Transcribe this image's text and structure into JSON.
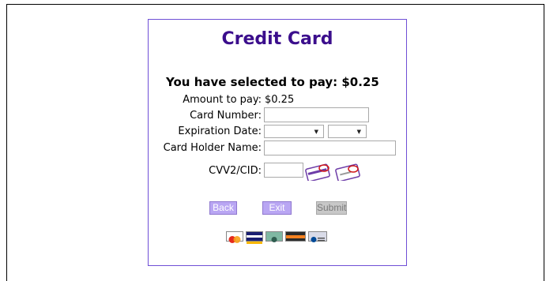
{
  "panel": {
    "title": "Credit Card",
    "headline": "You have selected to pay: $0.25"
  },
  "form": {
    "amount_label": "Amount to pay:",
    "amount_value": "$0.25",
    "card_number_label": "Card Number:",
    "card_number_value": "",
    "expiration_label": "Expiration Date:",
    "expiration_month": "",
    "expiration_year": "",
    "holder_label": "Card Holder Name:",
    "holder_value": "",
    "cvv_label": "CVV2/CID:",
    "cvv_value": ""
  },
  "buttons": {
    "back": "Back",
    "exit": "Exit",
    "submit": "Submit"
  },
  "icons": {
    "cvv_front": "card-front-cvv-icon",
    "cvv_back": "card-back-cvv-icon",
    "logos": [
      "mastercard-logo",
      "visa-logo",
      "generic-card-logo",
      "discover-logo",
      "diners-club-logo"
    ]
  },
  "colors": {
    "title": "#3b0e8c",
    "panel_border": "#6f4fd6",
    "button": "#b9a6f3"
  }
}
